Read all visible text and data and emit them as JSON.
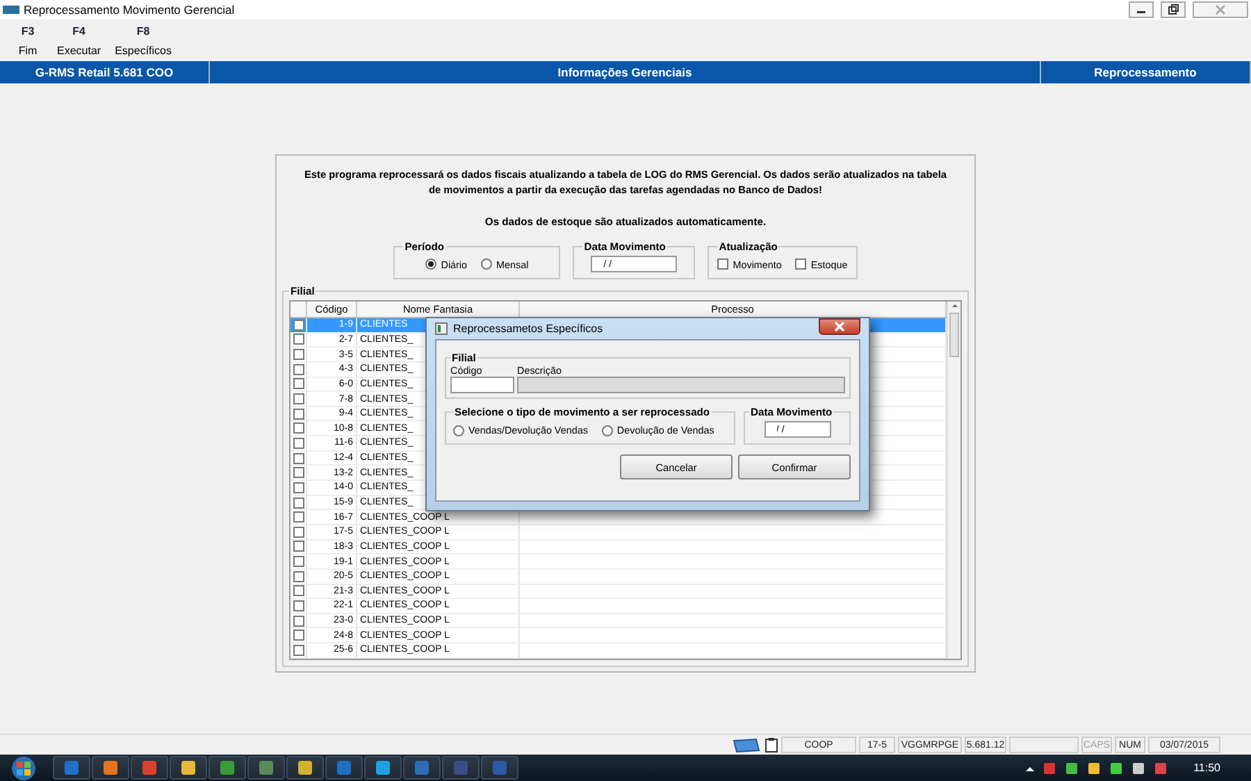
{
  "window": {
    "title": "Reprocessamento Movimento Gerencial"
  },
  "toolbar": [
    {
      "key": "F3",
      "label": "Fim"
    },
    {
      "key": "F4",
      "label": "Executar"
    },
    {
      "key": "F8",
      "label": "Específicos"
    }
  ],
  "header_bar": [
    "G-RMS Retail 5.681 COO",
    "Informações Gerenciais",
    "Reprocessamento"
  ],
  "notice": {
    "text": "Este programa reprocessará os dados fiscais atualizando a tabela de LOG do RMS Gerencial. Os dados serão atualizados na tabela de movimentos a partir da execução das tarefas agendadas no Banco de Dados!",
    "subtext": "Os dados de estoque são atualizados automaticamente."
  },
  "periodo": {
    "title": "Período",
    "options": [
      {
        "label": "Diário",
        "selected": true
      },
      {
        "label": "Mensal",
        "selected": false
      }
    ]
  },
  "data_movimento": {
    "title": "Data Movimento",
    "value": "/ /"
  },
  "atualizacao": {
    "title": "Atualização",
    "options": [
      {
        "label": "Movimento",
        "checked": false
      },
      {
        "label": "Estoque",
        "checked": false
      }
    ]
  },
  "filial": {
    "title": "Filial",
    "columns": [
      "Código",
      "Nome Fantasia",
      "Processo"
    ],
    "rows": [
      {
        "codigo": "1-9",
        "nome": "CLIENTES",
        "checked": false,
        "selected": true
      },
      {
        "codigo": "2-7",
        "nome": "CLIENTES_",
        "checked": false,
        "selected": false
      },
      {
        "codigo": "3-5",
        "nome": "CLIENTES_",
        "checked": false,
        "selected": false
      },
      {
        "codigo": "4-3",
        "nome": "CLIENTES_",
        "checked": false,
        "selected": false
      },
      {
        "codigo": "6-0",
        "nome": "CLIENTES_",
        "checked": false,
        "selected": false
      },
      {
        "codigo": "7-8",
        "nome": "CLIENTES_",
        "checked": false,
        "selected": false
      },
      {
        "codigo": "9-4",
        "nome": "CLIENTES_",
        "checked": false,
        "selected": false
      },
      {
        "codigo": "10-8",
        "nome": "CLIENTES_",
        "checked": false,
        "selected": false
      },
      {
        "codigo": "11-6",
        "nome": "CLIENTES_",
        "checked": false,
        "selected": false
      },
      {
        "codigo": "12-4",
        "nome": "CLIENTES_",
        "checked": false,
        "selected": false
      },
      {
        "codigo": "13-2",
        "nome": "CLIENTES_",
        "checked": false,
        "selected": false
      },
      {
        "codigo": "14-0",
        "nome": "CLIENTES_",
        "checked": false,
        "selected": false
      },
      {
        "codigo": "15-9",
        "nome": "CLIENTES_",
        "checked": false,
        "selected": false
      },
      {
        "codigo": "16-7",
        "nome": "CLIENTES_COOP L",
        "checked": false,
        "selected": false
      },
      {
        "codigo": "17-5",
        "nome": "CLIENTES_COOP L",
        "checked": false,
        "selected": false
      },
      {
        "codigo": "18-3",
        "nome": "CLIENTES_COOP L",
        "checked": false,
        "selected": false
      },
      {
        "codigo": "19-1",
        "nome": "CLIENTES_COOP L",
        "checked": false,
        "selected": false
      },
      {
        "codigo": "20-5",
        "nome": "CLIENTES_COOP L",
        "checked": false,
        "selected": false
      },
      {
        "codigo": "21-3",
        "nome": "CLIENTES_COOP L",
        "checked": false,
        "selected": false
      },
      {
        "codigo": "22-1",
        "nome": "CLIENTES_COOP L",
        "checked": false,
        "selected": false
      },
      {
        "codigo": "23-0",
        "nome": "CLIENTES_COOP L",
        "checked": false,
        "selected": false
      },
      {
        "codigo": "24-8",
        "nome": "CLIENTES_COOP L",
        "checked": false,
        "selected": false
      },
      {
        "codigo": "25-6",
        "nome": "CLIENTES_COOP L",
        "checked": false,
        "selected": false
      }
    ]
  },
  "dialog": {
    "title": "Reprocessametos Específicos",
    "filial_title": "Filial",
    "codigo_label": "Código",
    "descricao_label": "Descrição",
    "tipo_title": "Selecione o tipo de movimento a ser reprocessado",
    "tipo_options": [
      {
        "label": "Vendas/Devolução Vendas",
        "selected": false
      },
      {
        "label": "Devolução de Vendas",
        "selected": false
      }
    ],
    "data_title": "Data Movimento",
    "data_value": "/ /",
    "buttons": [
      "Cancelar",
      "Confirmar"
    ]
  },
  "status_bar": {
    "cells": [
      "COOP",
      "17-5",
      "VGGMRPGE",
      "5.681.12"
    ],
    "indicators": [
      {
        "label": "CAPS",
        "on": false
      },
      {
        "label": "NUM",
        "on": true
      }
    ],
    "date": "03/07/2015"
  },
  "taskbar": {
    "clock": "11:50"
  }
}
